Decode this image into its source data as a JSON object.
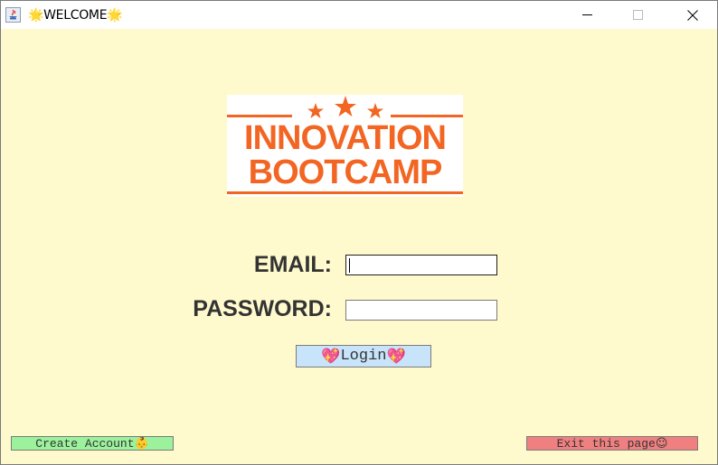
{
  "window": {
    "title": "WELCOME",
    "title_prefix_icon": "🌟",
    "title_suffix_icon": "🌟",
    "icon": "java-icon",
    "minimize_glyph": "—",
    "maximize_glyph": "☐",
    "close_glyph": "✕"
  },
  "logo": {
    "line1": "INNOVATION",
    "line2": "BOOTCAMP",
    "color": "#f26522"
  },
  "form": {
    "email_label": "EMAIL:",
    "password_label": "PASSWORD:",
    "email_value": "",
    "password_value": ""
  },
  "buttons": {
    "login_label": "Login",
    "login_icon": "💖",
    "create_label": "Create Account",
    "create_icon": "👶",
    "exit_label": "Exit this page",
    "exit_icon": "☺"
  },
  "colors": {
    "background": "#fffacd",
    "login_bg": "#c8e4fa",
    "create_bg": "#9cf29c",
    "exit_bg": "#f08080"
  }
}
